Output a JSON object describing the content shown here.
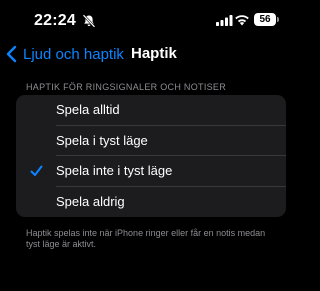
{
  "status_bar": {
    "time": "22:24",
    "battery": "56",
    "icons": [
      "bell-slash-icon",
      "cellular-signal-icon",
      "wifi-icon",
      "battery-icon"
    ]
  },
  "nav": {
    "back_label": "Ljud och haptik",
    "title": "Haptik"
  },
  "section": {
    "header": "HAPTIK FÖR RINGSIGNALER OCH NOTISER",
    "options": [
      {
        "label": "Spela alltid",
        "selected": false
      },
      {
        "label": "Spela i tyst läge",
        "selected": false
      },
      {
        "label": "Spela inte i tyst läge",
        "selected": true
      },
      {
        "label": "Spela aldrig",
        "selected": false
      }
    ],
    "footer": "Haptik spelas inte när iPhone ringer eller får en notis medan tyst läge är aktivt."
  },
  "colors": {
    "accent": "#0a84ff",
    "background": "#000000",
    "group_background": "#1c1c1e",
    "secondary_text": "#8e8e93"
  }
}
